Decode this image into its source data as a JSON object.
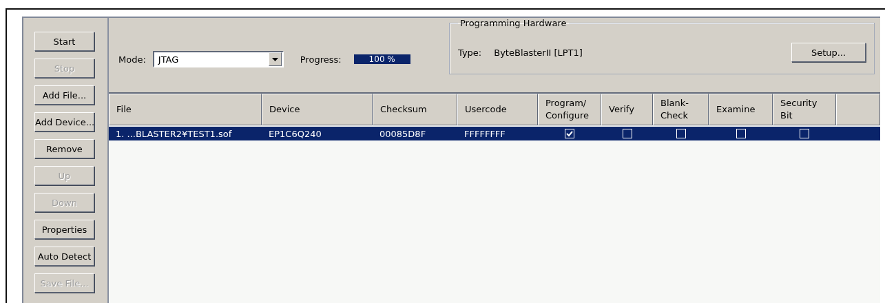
{
  "side_buttons": [
    {
      "label": "Start",
      "disabled": false
    },
    {
      "label": "Stop",
      "disabled": true
    },
    {
      "label": "Add File...",
      "disabled": false
    },
    {
      "label": "Add Device...",
      "disabled": false
    },
    {
      "label": "Remove",
      "disabled": false
    },
    {
      "label": "Up",
      "disabled": true
    },
    {
      "label": "Down",
      "disabled": true
    },
    {
      "label": "Properties",
      "disabled": false
    },
    {
      "label": "Auto Detect",
      "disabled": false
    },
    {
      "label": "Save File...",
      "disabled": true
    }
  ],
  "mode": {
    "label": "Mode:",
    "value": "JTAG"
  },
  "progress": {
    "label": "Progress:",
    "reading": "100 %",
    "level": 1
  },
  "hardware": {
    "title": "Programming Hardware",
    "type_label": "Type:",
    "type_value": "ByteBlasterII [LPT1]",
    "setup_button": "Setup..."
  },
  "table": {
    "columns": [
      "File",
      "Device",
      "Checksum",
      "Usercode",
      "Program/ Configure",
      "Verify",
      "Blank- Check",
      "Examine",
      "Security Bit"
    ],
    "rows": [
      {
        "selected": true,
        "file": "1. ...BLASTER2¥TEST1.sof",
        "device": "EP1C6Q240",
        "checksum": "00085D8F",
        "usercode": "FFFFFFFF",
        "program": true,
        "verify": false,
        "blank_check": false,
        "examine": false,
        "security_bit": false
      }
    ]
  }
}
